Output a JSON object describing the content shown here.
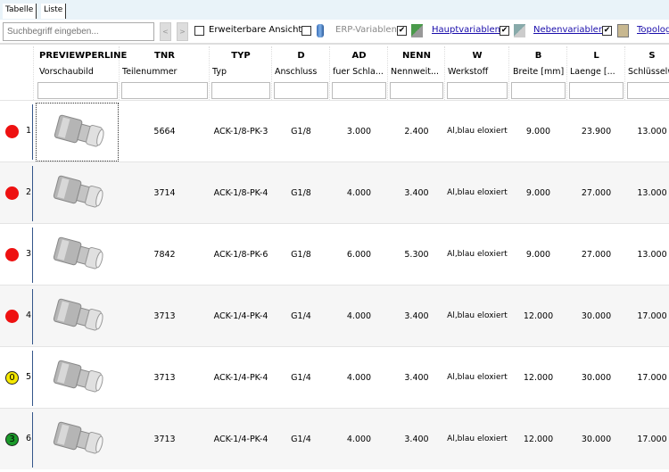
{
  "tabs": [
    {
      "label": "Tabelle"
    },
    {
      "label": "Liste"
    }
  ],
  "toolbar": {
    "search_placeholder": "Suchbegriff eingeben...",
    "prev": "<",
    "next": ">",
    "extended_view": "Erweiterbare Ansicht",
    "extended_view_checked": false,
    "erp_checked": false,
    "erp": "ERP-Variablen",
    "main_checked": true,
    "main": "Hauptvariablen",
    "secondary_checked": true,
    "secondary": "Nebenvariablen",
    "topology_checked": true,
    "topology": "Topolog"
  },
  "columns": [
    {
      "key": "PREVIEWPERLINE",
      "label": "Vorschaubild"
    },
    {
      "key": "TNR",
      "label": "Teilenummer"
    },
    {
      "key": "TYP",
      "label": "Typ"
    },
    {
      "key": "D",
      "label": "Anschluss"
    },
    {
      "key": "AD",
      "label": "fuer Schla..."
    },
    {
      "key": "NENN",
      "label": "Nennweit..."
    },
    {
      "key": "W",
      "label": "Werkstoff"
    },
    {
      "key": "B",
      "label": "Breite [mm]"
    },
    {
      "key": "L",
      "label": "Laenge [..."
    },
    {
      "key": "S",
      "label": "Schlüsselw"
    }
  ],
  "rows": [
    {
      "n": "1",
      "status": "red",
      "badge": "",
      "tnr": "5664",
      "typ": "ACK-1/8-PK-3",
      "d": "G1/8",
      "ad": "3.000",
      "nenn": "2.400",
      "w": "Al,blau eloxiert",
      "b": "9.000",
      "l": "23.900",
      "s": "13.000"
    },
    {
      "n": "2",
      "status": "red",
      "badge": "",
      "tnr": "3714",
      "typ": "ACK-1/8-PK-4",
      "d": "G1/8",
      "ad": "4.000",
      "nenn": "3.400",
      "w": "Al,blau eloxiert",
      "b": "9.000",
      "l": "27.000",
      "s": "13.000"
    },
    {
      "n": "3",
      "status": "red",
      "badge": "",
      "tnr": "7842",
      "typ": "ACK-1/8-PK-6",
      "d": "G1/8",
      "ad": "6.000",
      "nenn": "5.300",
      "w": "Al,blau eloxiert",
      "b": "9.000",
      "l": "27.000",
      "s": "13.000"
    },
    {
      "n": "4",
      "status": "red",
      "badge": "",
      "tnr": "3713",
      "typ": "ACK-1/4-PK-4",
      "d": "G1/4",
      "ad": "4.000",
      "nenn": "3.400",
      "w": "Al,blau eloxiert",
      "b": "12.000",
      "l": "30.000",
      "s": "17.000"
    },
    {
      "n": "5",
      "status": "yellow",
      "badge": "0",
      "tnr": "3713",
      "typ": "ACK-1/4-PK-4",
      "d": "G1/4",
      "ad": "4.000",
      "nenn": "3.400",
      "w": "Al,blau eloxiert",
      "b": "12.000",
      "l": "30.000",
      "s": "17.000"
    },
    {
      "n": "6",
      "status": "green",
      "badge": "3",
      "tnr": "3713",
      "typ": "ACK-1/4-PK-4",
      "d": "G1/4",
      "ad": "4.000",
      "nenn": "3.400",
      "w": "Al,blau eloxiert",
      "b": "12.000",
      "l": "30.000",
      "s": "17.000"
    }
  ],
  "colors": {
    "red": "#ee1111",
    "yellow": "#f5e800",
    "green": "#1a9a2a",
    "link": "#1a0dab"
  }
}
